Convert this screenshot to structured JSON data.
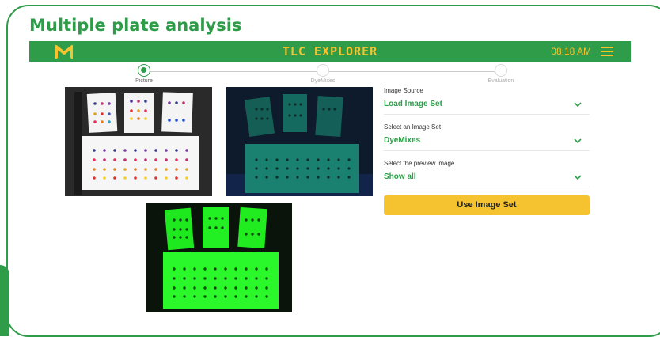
{
  "slide": {
    "title": "Multiple plate analysis"
  },
  "app": {
    "title": "TLC EXPLORER",
    "time": "08:18 AM",
    "logo_icon": "m-logo-icon",
    "menu_icon": "hamburger-menu-icon",
    "colors": {
      "brand_green": "#2e9c49",
      "accent_yellow": "#f5c330"
    }
  },
  "stepper": {
    "steps": [
      {
        "label": "Picture",
        "state": "active"
      },
      {
        "label": "DyeMixes",
        "state": "inactive"
      },
      {
        "label": "Evaluation",
        "state": "inactive"
      }
    ]
  },
  "images": [
    {
      "name": "white-light-preview"
    },
    {
      "name": "uv254-preview"
    },
    {
      "name": "fluorescence-preview"
    }
  ],
  "form": {
    "image_source": {
      "label": "Image Source",
      "value": "Load Image Set"
    },
    "image_set": {
      "label": "Select an Image Set",
      "value": "DyeMixes"
    },
    "preview": {
      "label": "Select the preview image",
      "value": "Show all"
    }
  },
  "actions": {
    "use_label": "Use Image Set"
  }
}
